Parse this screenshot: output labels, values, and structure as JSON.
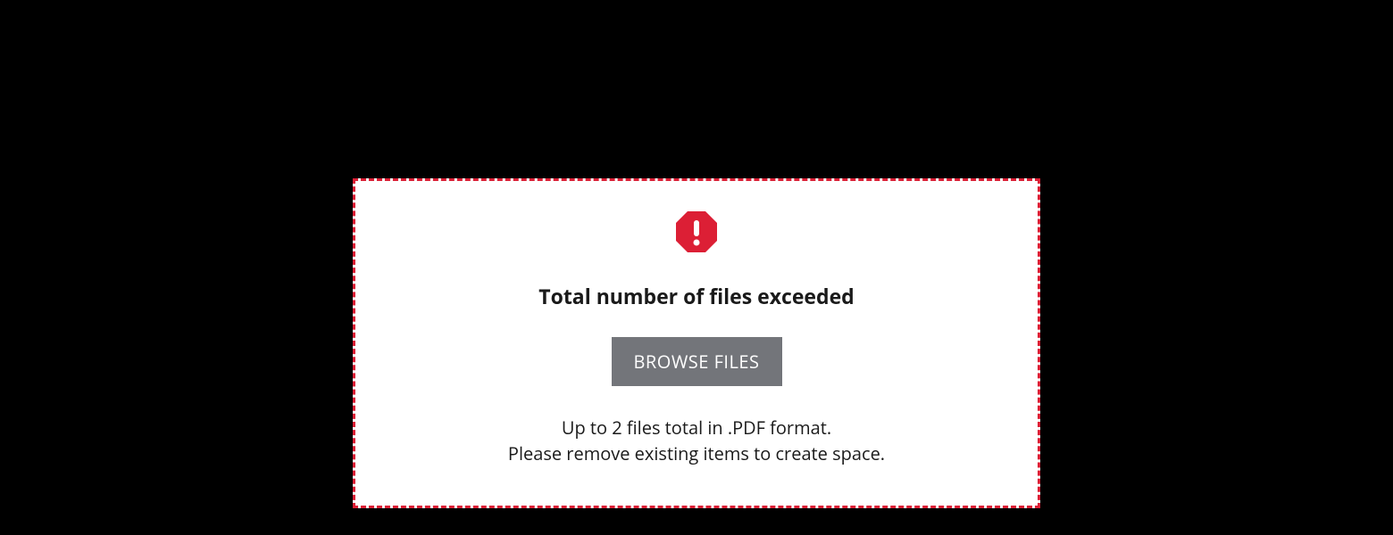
{
  "upload": {
    "error_title": "Total number of files exceeded",
    "browse_label": "BROWSE FILES",
    "help_line1": "Up to 2 files total in .PDF format.",
    "help_line2": "Please remove existing items to create space.",
    "icon_name": "alert-octagon",
    "colors": {
      "border": "#dc1f35",
      "icon": "#dc1f35",
      "button_bg": "#73757a",
      "button_text": "#ffffff"
    }
  }
}
